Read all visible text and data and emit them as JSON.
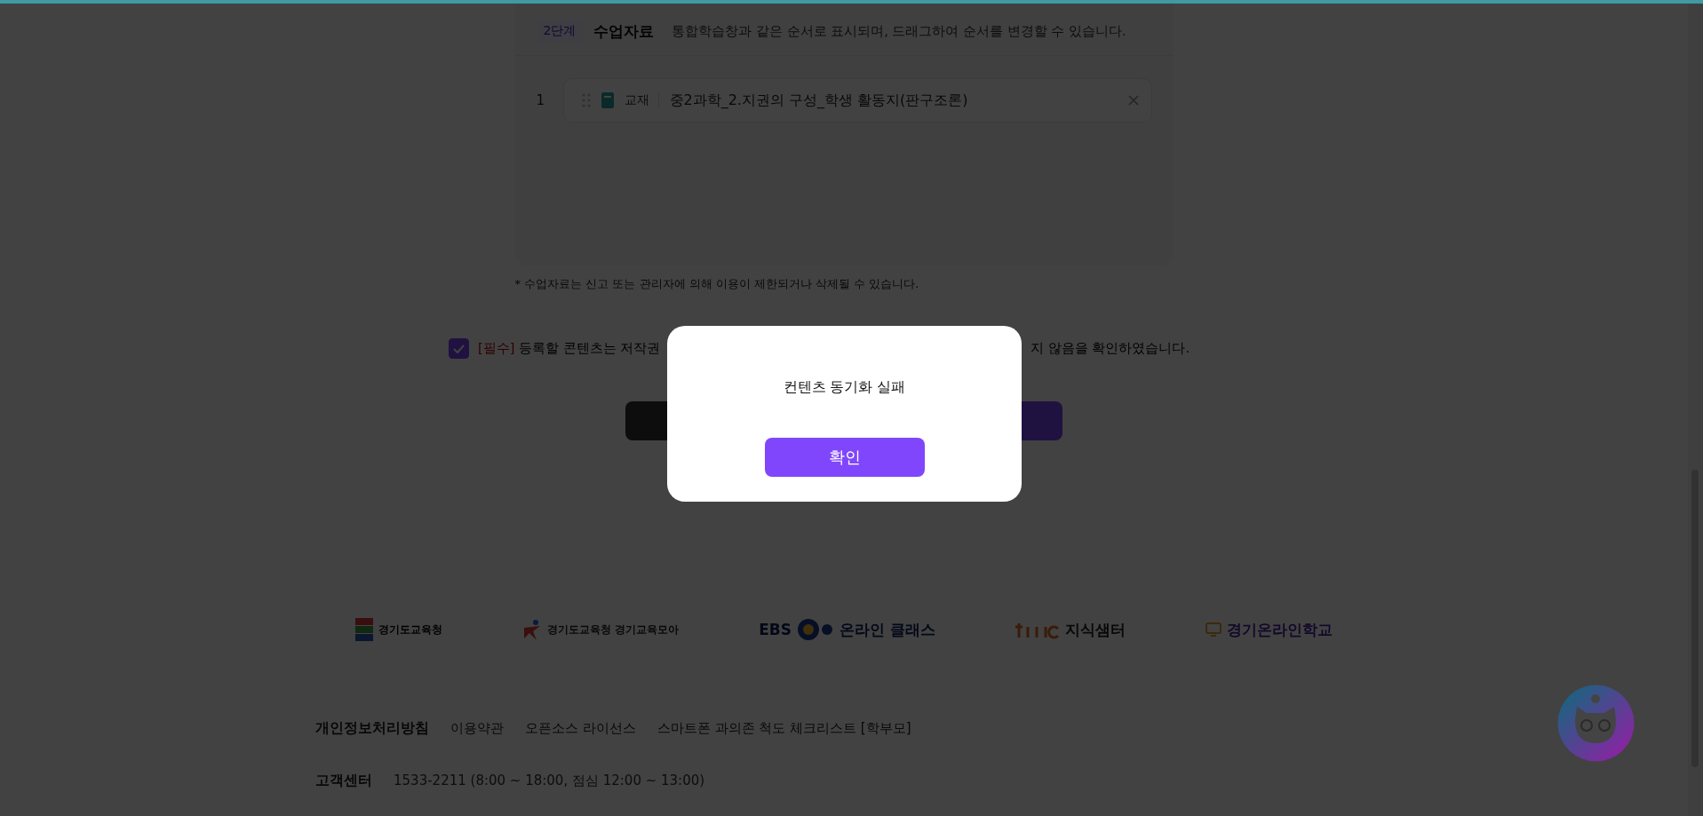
{
  "step": {
    "badge": "2단계",
    "title": "수업자료",
    "description": "통합학습창과 같은 순서로 표시되며, 드래그하여 순서를 변경할 수 있습니다."
  },
  "materials": [
    {
      "index": "1",
      "type": "교재",
      "title": "중2과학_2.지권의 구성_학생 활동지(판구조론)"
    }
  ],
  "note": "* 수업자료는 신고 또는 관리자에 의해 이용이 제한되거나 삭제될 수 있습니다.",
  "agreement": {
    "checked": true,
    "required": "[필수]",
    "text_before": "등록할 콘텐츠는 저작권",
    "text_after": "지 않음을 확인하였습니다."
  },
  "logos": [
    {
      "kind": "office",
      "text": "경기도교육청"
    },
    {
      "kind": "moa",
      "text": "경기도교육청 경기교육모아"
    },
    {
      "kind": "ebs",
      "brand": "EBS",
      "text": "온라인 클래스"
    },
    {
      "kind": "jisik",
      "text": "지식샘터"
    },
    {
      "kind": "online",
      "text": "경기온라인학교"
    }
  ],
  "footer_links": [
    {
      "label": "개인정보처리방침",
      "emphasized": true
    },
    {
      "label": "이용약관",
      "emphasized": false
    },
    {
      "label": "오픈소스 라이선스",
      "emphasized": false
    },
    {
      "label": "스마트폰 과의존 척도 체크리스트 [학부모]",
      "emphasized": false
    }
  ],
  "customer_center": {
    "label": "고객센터",
    "value": "1533-2211 (8:00 ~ 18:00, 점심 12:00 ~ 13:00)"
  },
  "dialog": {
    "message": "컨텐츠 동기화 실패",
    "confirm": "확인"
  }
}
